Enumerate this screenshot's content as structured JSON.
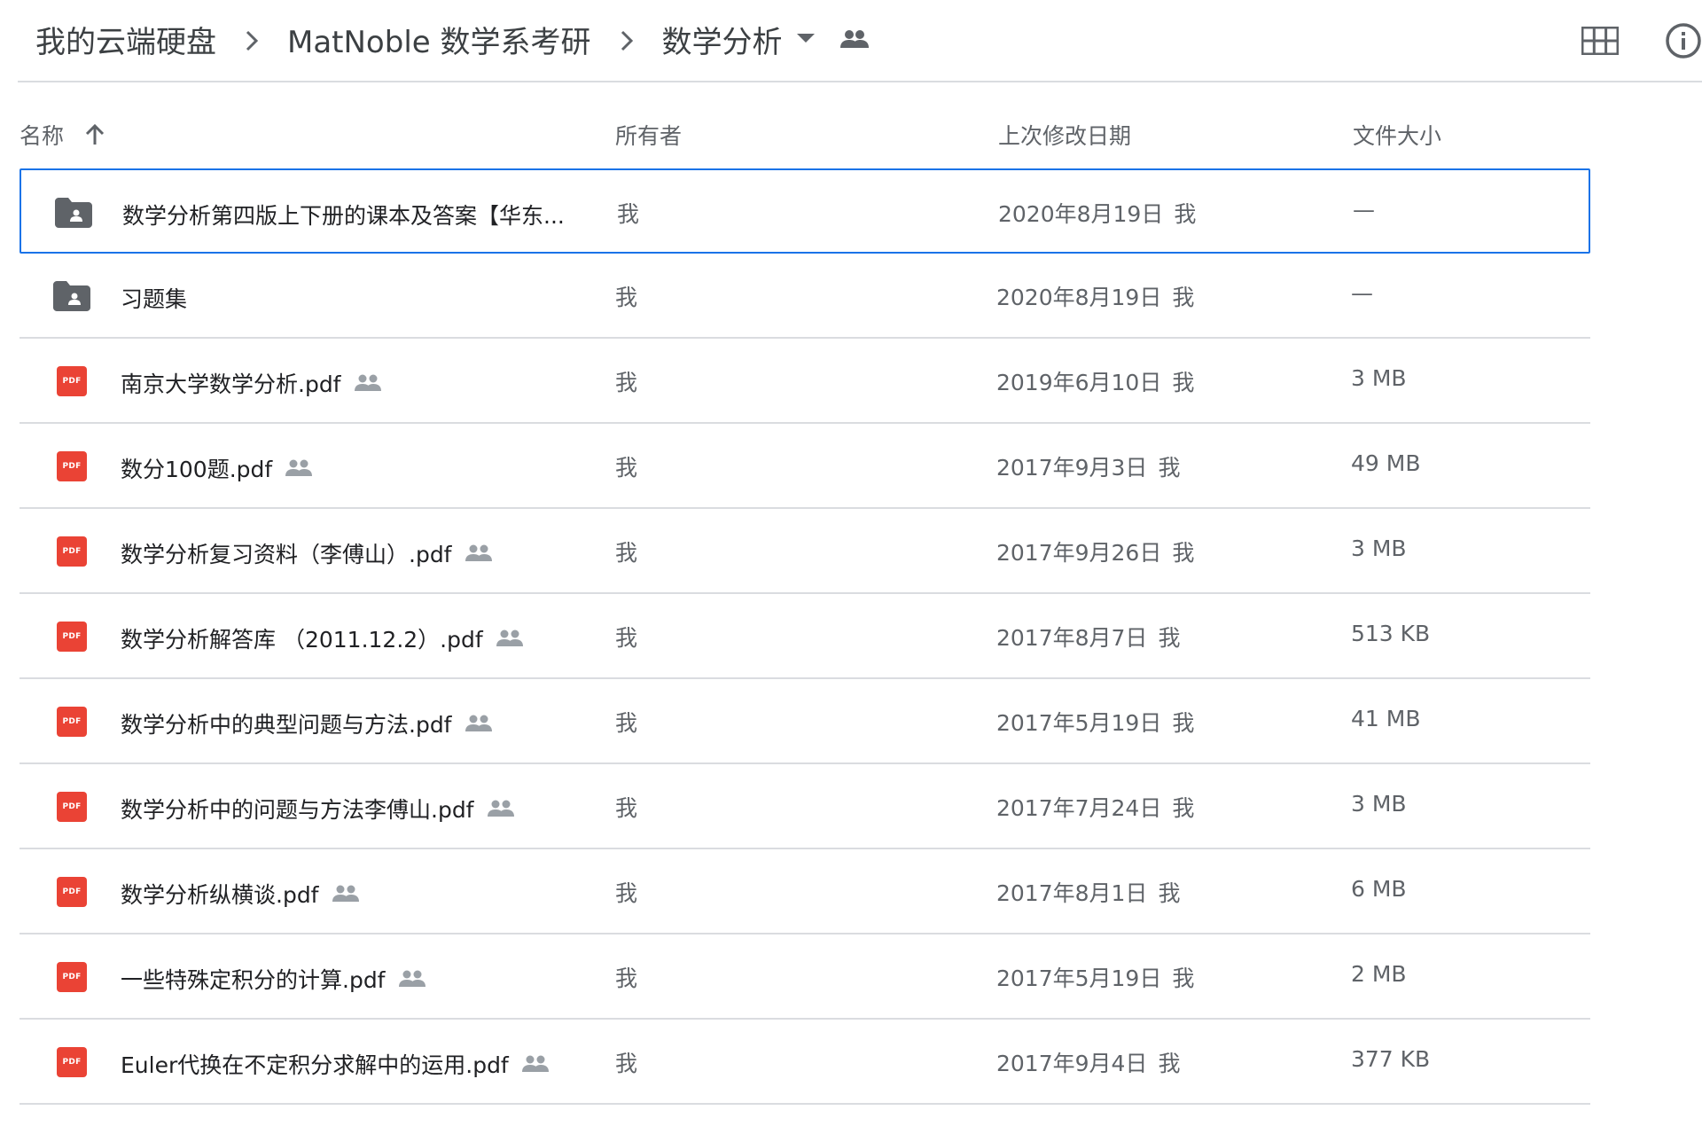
{
  "breadcrumb": {
    "items": [
      "我的云端硬盘",
      "MatNoble 数学系考研",
      "数学分析"
    ]
  },
  "columns": {
    "name": "名称",
    "owner": "所有者",
    "modified": "上次修改日期",
    "size": "文件大小"
  },
  "colors": {
    "accent": "#1a73e8",
    "pdf_red": "#ea4335",
    "folder_gray": "#5f6368",
    "divider": "#dadce0"
  },
  "files": [
    {
      "name": "数学分析第四版上下册的课本及答案【华东...",
      "type": "shared-folder",
      "shared": false,
      "owner": "我",
      "modified": "2020年8月19日",
      "modified_by": "我",
      "size": "—",
      "selected": true
    },
    {
      "name": "习题集",
      "type": "shared-folder",
      "shared": false,
      "owner": "我",
      "modified": "2020年8月19日",
      "modified_by": "我",
      "size": "—",
      "selected": false
    },
    {
      "name": "南京大学数学分析.pdf",
      "type": "pdf",
      "shared": true,
      "owner": "我",
      "modified": "2019年6月10日",
      "modified_by": "我",
      "size": "3 MB",
      "selected": false
    },
    {
      "name": "数分100题.pdf",
      "type": "pdf",
      "shared": true,
      "owner": "我",
      "modified": "2017年9月3日",
      "modified_by": "我",
      "size": "49 MB",
      "selected": false
    },
    {
      "name": "数学分析复习资料（李傅山）.pdf",
      "type": "pdf",
      "shared": true,
      "owner": "我",
      "modified": "2017年9月26日",
      "modified_by": "我",
      "size": "3 MB",
      "selected": false
    },
    {
      "name": "数学分析解答库 （2011.12.2）.pdf",
      "type": "pdf",
      "shared": true,
      "owner": "我",
      "modified": "2017年8月7日",
      "modified_by": "我",
      "size": "513 KB",
      "selected": false
    },
    {
      "name": "数学分析中的典型问题与方法.pdf",
      "type": "pdf",
      "shared": true,
      "owner": "我",
      "modified": "2017年5月19日",
      "modified_by": "我",
      "size": "41 MB",
      "selected": false
    },
    {
      "name": "数学分析中的问题与方法李傅山.pdf",
      "type": "pdf",
      "shared": true,
      "owner": "我",
      "modified": "2017年7月24日",
      "modified_by": "我",
      "size": "3 MB",
      "selected": false
    },
    {
      "name": "数学分析纵横谈.pdf",
      "type": "pdf",
      "shared": true,
      "owner": "我",
      "modified": "2017年8月1日",
      "modified_by": "我",
      "size": "6 MB",
      "selected": false
    },
    {
      "name": "一些特殊定积分的计算.pdf",
      "type": "pdf",
      "shared": true,
      "owner": "我",
      "modified": "2017年5月19日",
      "modified_by": "我",
      "size": "2 MB",
      "selected": false
    },
    {
      "name": "Euler代换在不定积分求解中的运用.pdf",
      "type": "pdf",
      "shared": true,
      "owner": "我",
      "modified": "2017年9月4日",
      "modified_by": "我",
      "size": "377 KB",
      "selected": false
    }
  ],
  "icons": {
    "folder": "shared-folder-icon",
    "pdf": "pdf-file-icon",
    "pdf_label": "PDF",
    "shared": "people-icon",
    "view_toggle": "grid-view-icon",
    "details": "info-icon",
    "sort": "arrow-up-icon",
    "breadcrumb_sep": "chevron-right-icon",
    "dropdown": "caret-down-icon"
  }
}
